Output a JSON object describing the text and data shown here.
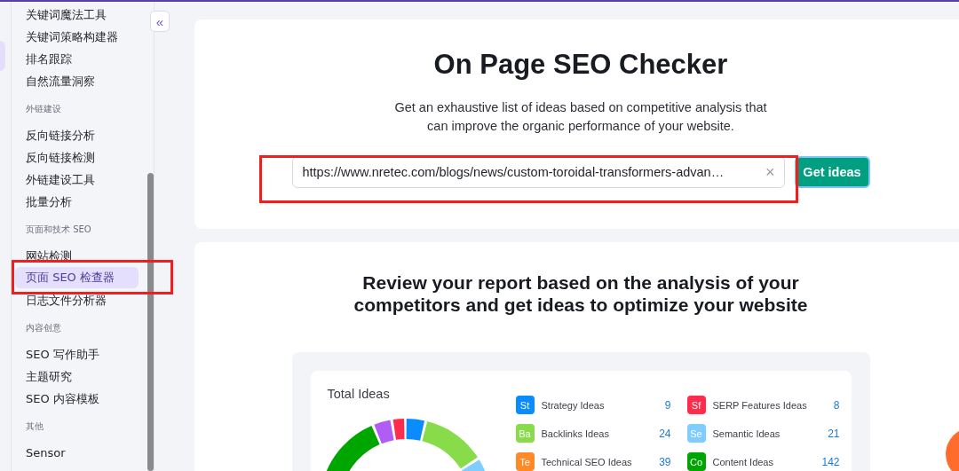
{
  "sidebar": {
    "sections": [
      {
        "items": [
          {
            "label": "关键词魔法工具",
            "selected": false
          },
          {
            "label": "关键词策略构建器",
            "selected": false
          },
          {
            "label": "排名跟踪",
            "selected": false
          },
          {
            "label": "自然流量洞察",
            "selected": false
          }
        ]
      },
      {
        "heading": "外链建设",
        "items": [
          {
            "label": "反向链接分析",
            "selected": false
          },
          {
            "label": "反向链接检测",
            "selected": false
          },
          {
            "label": "外链建设工具",
            "selected": false
          },
          {
            "label": "批量分析",
            "selected": false
          }
        ]
      },
      {
        "heading": "页面和技术 SEO",
        "items": [
          {
            "label": "网站检测",
            "selected": false
          },
          {
            "label": "页面 SEO 检查器",
            "selected": true
          },
          {
            "label": "日志文件分析器",
            "selected": false
          }
        ]
      },
      {
        "heading": "内容创意",
        "items": [
          {
            "label": "SEO 写作助手",
            "selected": false
          },
          {
            "label": "主题研究",
            "selected": false
          },
          {
            "label": "SEO 内容模板",
            "selected": false
          }
        ]
      },
      {
        "heading": "其他",
        "items": [
          {
            "label": "Sensor",
            "selected": false
          }
        ]
      }
    ]
  },
  "collapse_button": "«",
  "hero": {
    "title": "On Page SEO Checker",
    "description": "Get an exhaustive list of ideas based on competitive analysis that can improve the organic performance of your website.",
    "url_field": {
      "value": "https://www.nretec.com/blogs/news/custom-toroidal-transformers-advan…"
    },
    "clear": "×",
    "button": "Get ideas"
  },
  "report": {
    "heading": "Review your report based on the analysis of your competitors and get ideas to optimize your website",
    "card_title": "Total Ideas",
    "ideas": [
      {
        "abbr": "St",
        "label": "Strategy Ideas",
        "count": "9",
        "color": "#0a8cff"
      },
      {
        "abbr": "Sf",
        "label": "SERP Features Ideas",
        "count": "8",
        "color": "#ff2d4b"
      },
      {
        "abbr": "Ba",
        "label": "Backlinks Ideas",
        "count": "24",
        "color": "#89dc49"
      },
      {
        "abbr": "Se",
        "label": "Semantic Ideas",
        "count": "21",
        "color": "#7fcdff"
      },
      {
        "abbr": "Te",
        "label": "Technical SEO Ideas",
        "count": "39",
        "color": "#ff8a26"
      },
      {
        "abbr": "Co",
        "label": "Content Ideas",
        "count": "142",
        "color": "#00a600"
      }
    ]
  }
}
